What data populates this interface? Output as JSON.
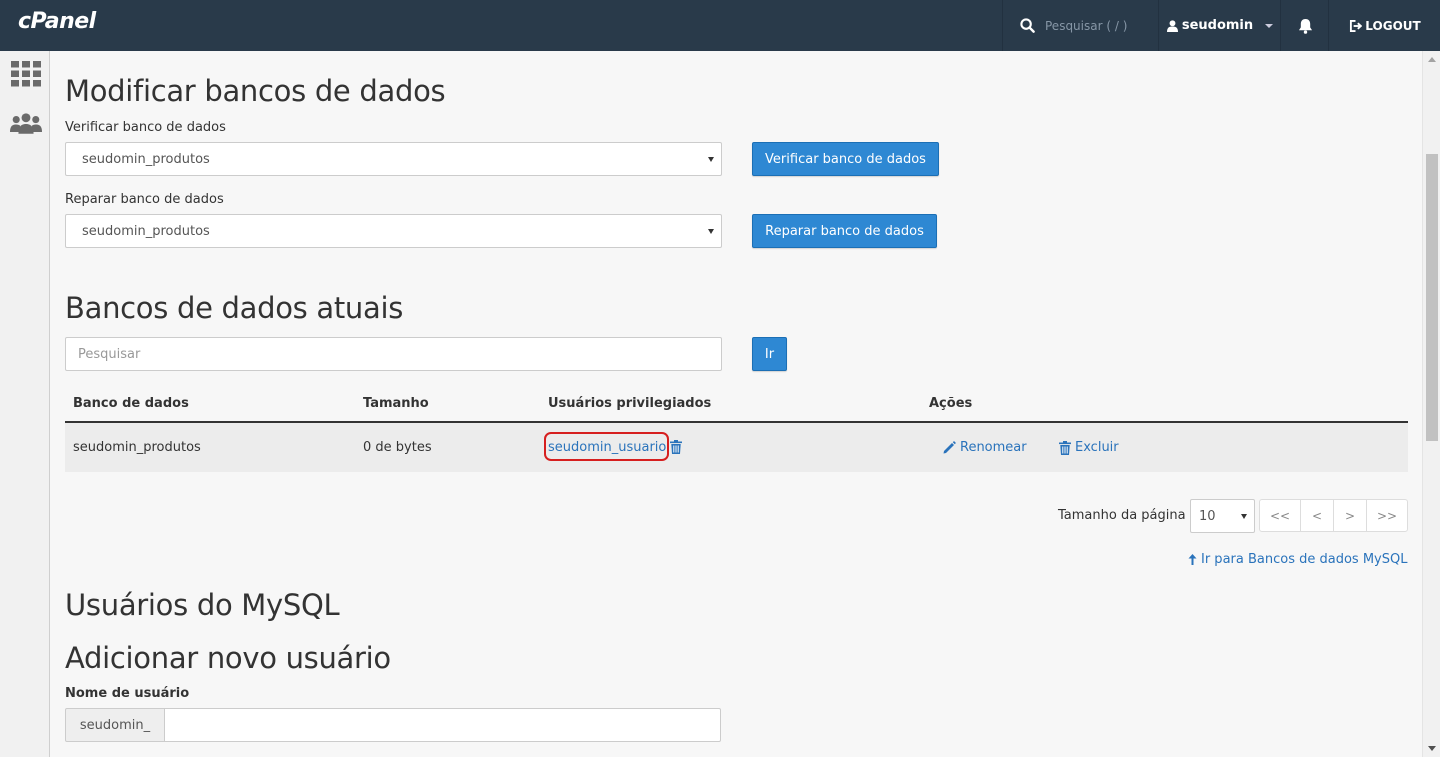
{
  "topbar": {
    "logo": "cPanel",
    "search_placeholder": "Pesquisar ( / )",
    "username": "seudomin",
    "logout_label": "LOGOUT"
  },
  "sidebar": {
    "items": [
      {
        "icon": "grid-icon"
      },
      {
        "icon": "users-icon"
      }
    ]
  },
  "modify": {
    "title": "Modificar bancos de dados",
    "check_label": "Verificar banco de dados",
    "check_selected": "seudomin_produtos",
    "check_button": "Verificar banco de dados",
    "repair_label": "Reparar banco de dados",
    "repair_selected": "seudomin_produtos",
    "repair_button": "Reparar banco de dados"
  },
  "current": {
    "title": "Bancos de dados atuais",
    "search_placeholder": "Pesquisar",
    "go_button": "Ir",
    "columns": [
      "Banco de dados",
      "Tamanho",
      "Usuários privilegiados",
      "Ações"
    ],
    "rows": [
      {
        "database": "seudomin_produtos",
        "size": "0 de bytes",
        "user": "seudomin_usuario",
        "rename": "Renomear",
        "delete": "Excluir"
      }
    ],
    "page_size_label": "Tamanho da página",
    "page_size": "10",
    "pager": [
      "<<",
      "<",
      ">",
      ">>"
    ],
    "goto_link": "Ir para Bancos de dados MySQL"
  },
  "users": {
    "title": "Usuários do MySQL",
    "add_title": "Adicionar novo usuário",
    "username_label": "Nome de usuário",
    "username_prefix": "seudomin_",
    "username_value": ""
  },
  "colors": {
    "topbar": "#293a4a",
    "primary": "#2e88d3",
    "link": "#2a73bb",
    "highlight": "#d61f1f"
  }
}
